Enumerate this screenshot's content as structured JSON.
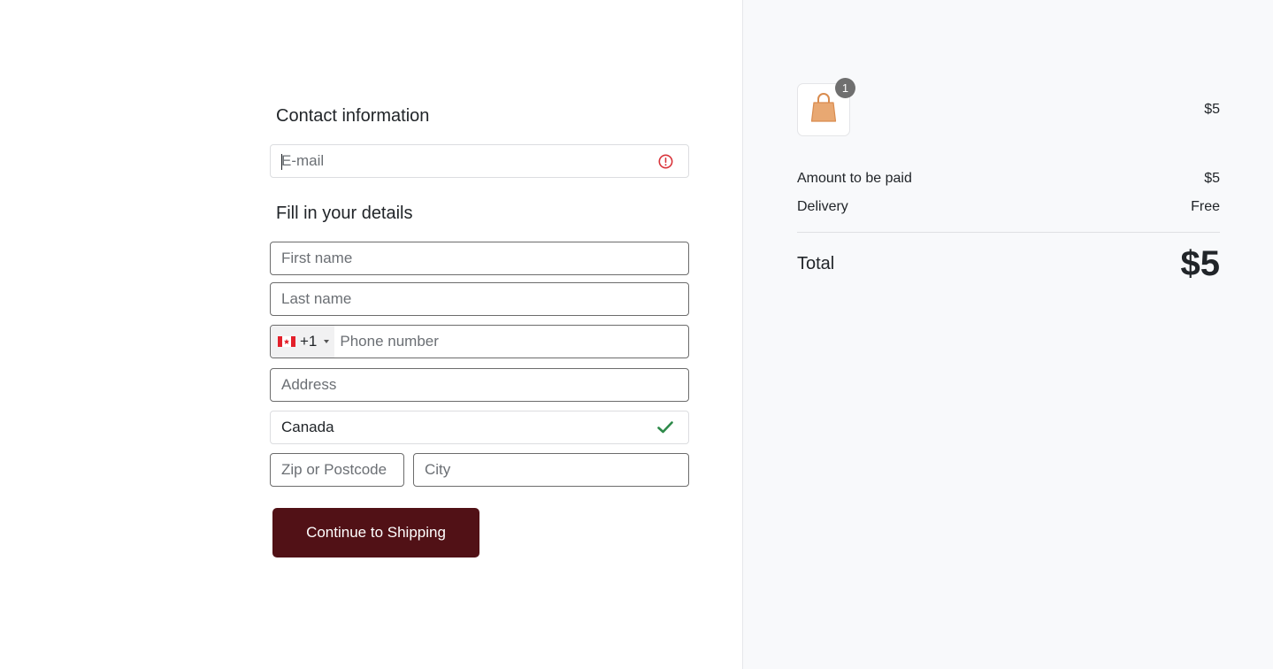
{
  "contact": {
    "title": "Contact information",
    "email_placeholder": "E-mail",
    "email_value": "",
    "email_status_icon": "error-circle-icon"
  },
  "details": {
    "title": "Fill in your details",
    "first_name_placeholder": "First name",
    "last_name_placeholder": "Last name",
    "phone": {
      "country_flag": "canada-flag-icon",
      "dial_code": "+1",
      "placeholder": "Phone number"
    },
    "address_placeholder": "Address",
    "country": {
      "value": "Canada",
      "status_icon": "check-icon"
    },
    "zip_placeholder": "Zip or Postcode",
    "city_placeholder": "City"
  },
  "actions": {
    "continue_label": "Continue to Shipping"
  },
  "summary": {
    "item": {
      "icon": "shopping-bag-icon",
      "quantity": "1",
      "price": "$5"
    },
    "rows": [
      {
        "label": "Amount to be paid",
        "value": "$5"
      },
      {
        "label": "Delivery",
        "value": "Free"
      }
    ],
    "total_label": "Total",
    "total_value": "$5"
  },
  "colors": {
    "primary_button": "#511116",
    "error": "#d9343b",
    "success": "#2e8a4a",
    "summary_bg": "#f8f9fb"
  }
}
